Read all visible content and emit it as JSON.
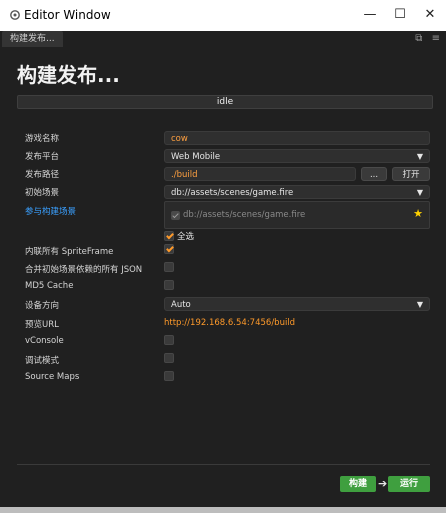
{
  "window": {
    "title": "Editor Window",
    "controls": {
      "minimize": "—",
      "maximize": "☐",
      "close": "✕"
    }
  },
  "tab": {
    "label": "构建发布..."
  },
  "panel": {
    "heading": "构建发布...",
    "status": {
      "text": "idle",
      "progress": 0
    }
  },
  "form": {
    "game_name": {
      "label": "游戏名称",
      "value": "cow"
    },
    "platform": {
      "label": "发布平台",
      "value": "Web Mobile"
    },
    "build_path": {
      "label": "发布路径",
      "value": "./build",
      "browse_label": "...",
      "open_label": "打开"
    },
    "start_scene": {
      "label": "初始场景",
      "value": "db://assets/scenes/game.fire"
    },
    "scenes": {
      "label": "参与构建场景",
      "item": "db://assets/scenes/game.fire",
      "select_all_label": "全选"
    },
    "inline_spriteframe": {
      "label": "内联所有 SpriteFrame",
      "checked": true
    },
    "merge_json": {
      "label": "合并初始场景依赖的所有 JSON",
      "checked": false
    },
    "md5_cache": {
      "label": "MD5 Cache",
      "checked": false
    },
    "orientation": {
      "label": "设备方向",
      "value": "Auto"
    },
    "preview_url": {
      "label": "预览URL",
      "value": "http://192.168.6.54:7456/build"
    },
    "vconsole": {
      "label": "vConsole",
      "checked": false
    },
    "debug_mode": {
      "label": "调试模式",
      "checked": false
    },
    "source_maps": {
      "label": "Source Maps",
      "checked": false
    }
  },
  "footer": {
    "build_label": "构建",
    "run_label": "运行"
  },
  "colors": {
    "accent": "#ff9a2a",
    "link": "#3aa0ff",
    "build_green": "#3f9f3f"
  }
}
